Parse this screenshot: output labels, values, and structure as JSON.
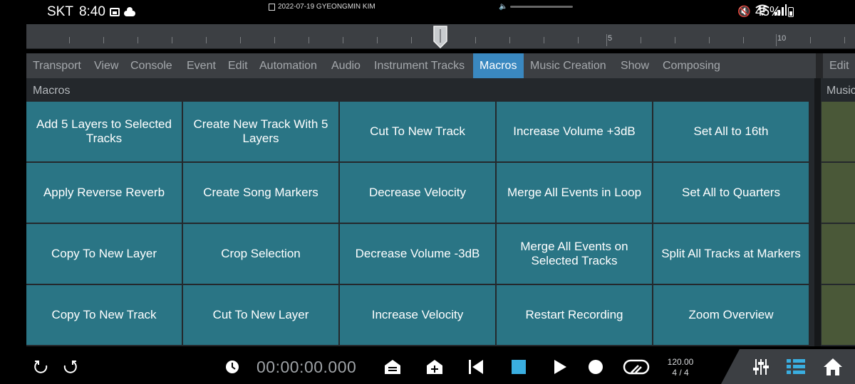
{
  "status_bar": {
    "carrier": "SKT",
    "time": "8:40",
    "notification": "2022-07-19 GYEONGMIN KIM",
    "battery": "45%"
  },
  "ruler": {
    "labels": [
      "5",
      "10"
    ]
  },
  "menu": {
    "items": [
      "Transport",
      "View",
      "Console",
      "Event",
      "Edit",
      "Automation",
      "Audio",
      "Instrument Tracks",
      "Macros",
      "Music Creation",
      "Show",
      "Composing"
    ],
    "active": "Macros",
    "right_item": "Edit"
  },
  "panel": {
    "title": "Macros",
    "side_title": "Music",
    "buttons": [
      "Add 5 Layers to Selected Tracks",
      "Create New Track With 5 Layers",
      "Cut To New Track",
      "Increase Volume +3dB",
      "Set All to 16th",
      "Apply Reverse Reverb",
      "Create Song Markers",
      "Decrease Velocity",
      "Merge All Events in Loop",
      "Set All to Quarters",
      "Copy To New Layer",
      "Crop Selection",
      "Decrease Volume -3dB",
      "Merge All Events on Selected Tracks",
      "Split All Tracks at Markers",
      "Copy To New Track",
      "Cut To New Layer",
      "Increase Velocity",
      "Restart Recording",
      "Zoom Overview"
    ]
  },
  "transport": {
    "timecode": "00:00:00.000",
    "tempo": "120.00",
    "signature": "4 / 4",
    "icons": [
      "undo-icon",
      "redo-icon",
      "clock-icon",
      "marker-icon",
      "add-marker-icon",
      "rewind-icon",
      "stop-icon",
      "play-icon",
      "record-icon",
      "loop-icon",
      "mixer-icon",
      "browser-icon",
      "home-icon"
    ]
  },
  "colors": {
    "active_tab": "#3a88c0",
    "macro_button": "#2a7585",
    "accent_icon": "#3aaee0",
    "panel_bg": "#24282c",
    "bar_bg": "#3c3f43"
  }
}
